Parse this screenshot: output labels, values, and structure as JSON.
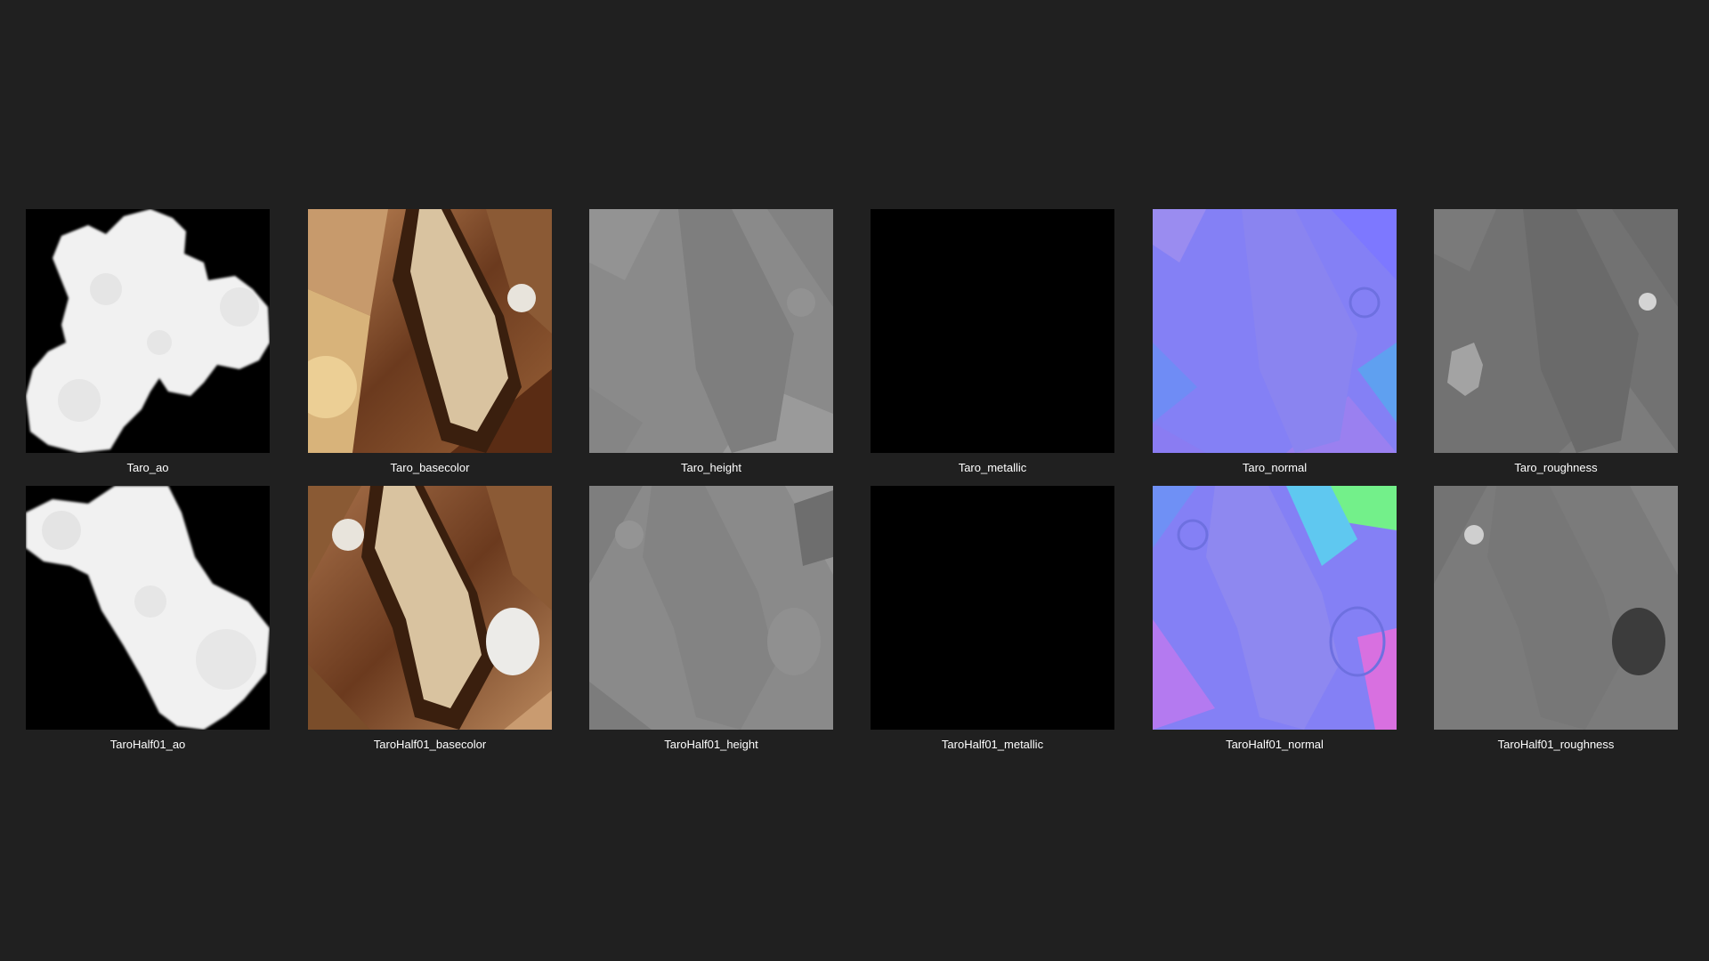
{
  "explorer": {
    "background": "#202020",
    "caption_color": "#ffffff"
  },
  "rows": [
    {
      "files": [
        {
          "name": "Taro_ao",
          "icon": "ao-map-thumbnail"
        },
        {
          "name": "Taro_basecolor",
          "icon": "basecolor-map-thumbnail"
        },
        {
          "name": "Taro_height",
          "icon": "height-map-thumbnail"
        },
        {
          "name": "Taro_metallic",
          "icon": "metallic-map-thumbnail"
        },
        {
          "name": "Taro_normal",
          "icon": "normal-map-thumbnail"
        },
        {
          "name": "Taro_roughness",
          "icon": "roughness-map-thumbnail"
        }
      ]
    },
    {
      "files": [
        {
          "name": "TaroHalf01_ao",
          "icon": "ao-map-thumbnail"
        },
        {
          "name": "TaroHalf01_basecolor",
          "icon": "basecolor-map-thumbnail"
        },
        {
          "name": "TaroHalf01_height",
          "icon": "height-map-thumbnail"
        },
        {
          "name": "TaroHalf01_metallic",
          "icon": "metallic-map-thumbnail"
        },
        {
          "name": "TaroHalf01_normal",
          "icon": "normal-map-thumbnail"
        },
        {
          "name": "TaroHalf01_roughness",
          "icon": "roughness-map-thumbnail"
        }
      ]
    }
  ]
}
